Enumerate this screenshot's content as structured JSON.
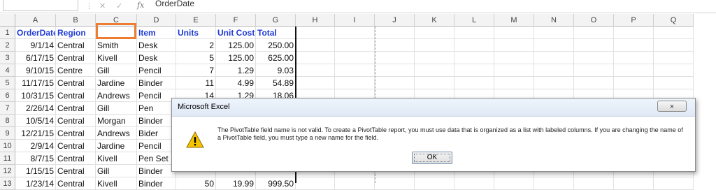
{
  "formula_bar": {
    "name_box": "",
    "formula": "OrderDate",
    "fx": "fx"
  },
  "columns": [
    "A",
    "B",
    "C",
    "D",
    "E",
    "F",
    "G",
    "H",
    "I",
    "J",
    "K",
    "L",
    "M",
    "N",
    "O",
    "P",
    "Q"
  ],
  "rows": [
    "1",
    "2",
    "3",
    "4",
    "5",
    "6",
    "7",
    "8",
    "9",
    "10",
    "11",
    "12",
    "13"
  ],
  "table": {
    "headers": [
      "OrderDate",
      "Region",
      "",
      "Item",
      "Units",
      "Unit Cost",
      "Total"
    ],
    "data": [
      [
        "9/1/14",
        "Central",
        "Smith",
        "Desk",
        "2",
        "125.00",
        "250.00"
      ],
      [
        "6/17/15",
        "Central",
        "Kivell",
        "Desk",
        "5",
        "125.00",
        "625.00"
      ],
      [
        "9/10/15",
        "Centre",
        "Gill",
        "Pencil",
        "7",
        "1.29",
        "9.03"
      ],
      [
        "11/17/15",
        "Central",
        "Jardine",
        "Binder",
        "11",
        "4.99",
        "54.89"
      ],
      [
        "10/31/15",
        "Central",
        "Andrews",
        "Pencil",
        "14",
        "1.29",
        "18.06"
      ],
      [
        "2/26/14",
        "Central",
        "Gill",
        "Pen",
        "",
        "",
        ""
      ],
      [
        "10/5/14",
        "Central",
        "Morgan",
        "Binder",
        "",
        "",
        ""
      ],
      [
        "12/21/15",
        "Central",
        "Andrews",
        "Bider",
        "",
        "",
        ""
      ],
      [
        "2/9/14",
        "Central",
        "Jardine",
        "Pencil",
        "",
        "",
        ""
      ],
      [
        "8/7/15",
        "Central",
        "Kivell",
        "Pen Set",
        "",
        "",
        ""
      ],
      [
        "1/15/15",
        "Central",
        "Gill",
        "Binder",
        "",
        "",
        ""
      ],
      [
        "1/23/14",
        "Central",
        "Kivell",
        "Binder",
        "50",
        "19.99",
        "999.50"
      ]
    ]
  },
  "dialog": {
    "title": "Microsoft Excel",
    "close_label": "×",
    "message": "The PivotTable field name is not valid. To create a PivotTable report, you must use data that is organized as a list with labeled columns. If you are changing the name of a PivotTable field, you must type a new name for the field.",
    "ok_label": "OK",
    "icon": "warning-icon"
  },
  "colors": {
    "header_text": "#1f3bd6",
    "highlight": "#ed7d31"
  }
}
